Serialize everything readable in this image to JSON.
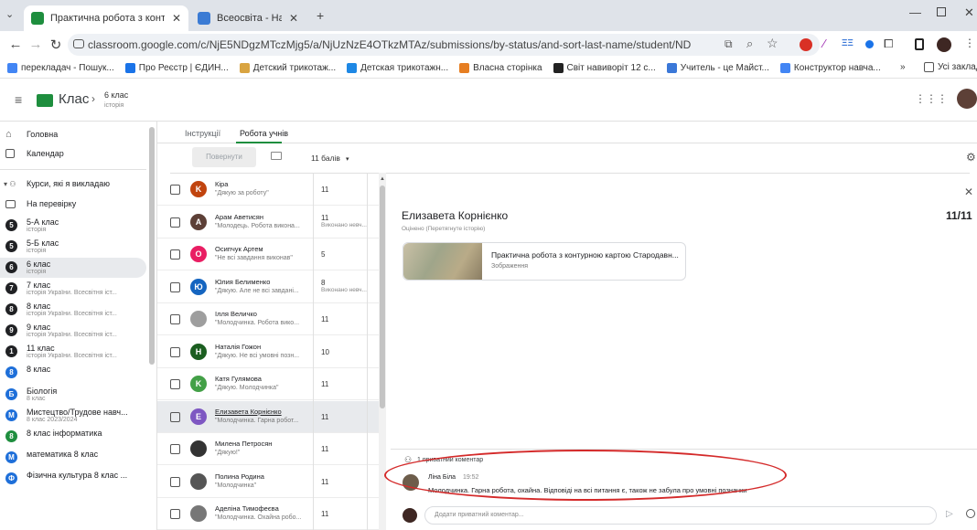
{
  "browser": {
    "tabs": [
      {
        "title": "Практична робота з контурно",
        "close": "✕"
      },
      {
        "title": "Всеосвіта - Національна освіт",
        "close": "✕"
      }
    ],
    "new_tab": "+",
    "url": "classroom.google.com/c/NjE5NDgzMTczMjg5/a/NjUzNzE4OTkzMTAz/submissions/by-status/and-sort-last-name/student/NDIyMDI5MDA0ODMx",
    "bookmarks": [
      {
        "label": "перекладач - Пошук...",
        "color": "#4285f4"
      },
      {
        "label": "Про Реєстр | ЄДИН...",
        "color": "#1a73e8"
      },
      {
        "label": "Детский трикотаж...",
        "color": "#d9a441"
      },
      {
        "label": "Детская трикотажн...",
        "color": "#1e88e5"
      },
      {
        "label": "Власна сторінка",
        "color": "#e67e22"
      },
      {
        "label": "Світ навиворіт 12 с...",
        "color": "#222222"
      },
      {
        "label": "Учитель - це Майст...",
        "color": "#3b78d8"
      },
      {
        "label": "Конструктор навча...",
        "color": "#4285f4"
      }
    ],
    "bookmarks_more": "»",
    "all_bookmarks": "Усі заклад"
  },
  "app": {
    "class_label": "Клас",
    "crumb_title": "6 клас",
    "crumb_sub": "історія"
  },
  "sidebar": {
    "home": "Головна",
    "calendar": "Календар",
    "teaching": "Курси, які я викладаю",
    "review": "На перевірку",
    "classes": [
      {
        "letter": "5",
        "title": "5-А клас",
        "sub": "історія",
        "color": "#202124"
      },
      {
        "letter": "5",
        "title": "5-Б клас",
        "sub": "історія",
        "color": "#202124"
      },
      {
        "letter": "6",
        "title": "6 клас",
        "sub": "історія",
        "color": "#202124"
      },
      {
        "letter": "7",
        "title": "7 клас",
        "sub": "історія України. Всесвітня іст...",
        "color": "#202124"
      },
      {
        "letter": "8",
        "title": "8 клас",
        "sub": "історія України. Всесвітня іст...",
        "color": "#202124"
      },
      {
        "letter": "9",
        "title": "9 клас",
        "sub": "історія України. Всесвітня іст...",
        "color": "#202124"
      },
      {
        "letter": "1",
        "title": "11 клас",
        "sub": "історія України. Всесвітня іст...",
        "color": "#202124"
      },
      {
        "letter": "8",
        "title": "8 клас",
        "sub": "",
        "color": "#1e6fd9"
      },
      {
        "letter": "Б",
        "title": "Біологія",
        "sub": "8 клас",
        "color": "#1e6fd9"
      },
      {
        "letter": "М",
        "title": "Мистецтво/Трудове навч...",
        "sub": "8 клас 2023/2024",
        "color": "#1e6fd9"
      },
      {
        "letter": "8",
        "title": "8 клас інформатика",
        "sub": "",
        "color": "#1e8e3e"
      },
      {
        "letter": "М",
        "title": "математика 8 клас",
        "sub": "",
        "color": "#1e6fd9"
      },
      {
        "letter": "Ф",
        "title": "Фізична культура 8 клас ...",
        "sub": "",
        "color": "#1e6fd9"
      }
    ]
  },
  "main": {
    "tabs": [
      "Інструкції",
      "Робота учнів"
    ],
    "return_button": "Повернути",
    "points_select": "11 балів",
    "students": [
      {
        "initial": "K",
        "color": "#c1440e",
        "name": "Кіра",
        "comment": "\"Дякую за роботу\"",
        "grade": "11",
        "grade_sub": ""
      },
      {
        "initial": "A",
        "color": "#5d4037",
        "name": "Арам Аветисян",
        "comment": "\"Молодець. Робота викона...",
        "grade": "11",
        "grade_sub": "Виконано невч..."
      },
      {
        "initial": "O",
        "color": "#e91e63",
        "name": "Осипчук Артем",
        "comment": "\"Не всі завдання виконав\"",
        "grade": "5",
        "grade_sub": ""
      },
      {
        "initial": "Ю",
        "color": "#1565c0",
        "name": "Юлия Белименко",
        "comment": "\"Дякую. Але не всі завдані...",
        "grade": "8",
        "grade_sub": "Виконано невч..."
      },
      {
        "initial": "",
        "color": "#9e9e9e",
        "name": "Ілля Величко",
        "comment": "\"Молодчинка. Робота вико...",
        "grade": "11",
        "grade_sub": ""
      },
      {
        "initial": "H",
        "color": "#1b5e20",
        "name": "Наталія Гожон",
        "comment": "\"Дякую. Не всі умовні позн...",
        "grade": "10",
        "grade_sub": ""
      },
      {
        "initial": "K",
        "color": "#43a047",
        "name": "Катя Гулямова",
        "comment": "\"Дякую. Молодчинка\"",
        "grade": "11",
        "grade_sub": ""
      },
      {
        "initial": "E",
        "color": "#7e57c2",
        "name": "Елизавета Корнієнко",
        "comment": "\"Молодчинка. Гарна робот...",
        "grade": "11",
        "grade_sub": ""
      },
      {
        "initial": "",
        "color": "#333333",
        "name": "Милена Петросян",
        "comment": "\"Дякую!\"",
        "grade": "11",
        "grade_sub": ""
      },
      {
        "initial": "",
        "color": "#555555",
        "name": "Полина Родина",
        "comment": "\"Молодчинка\"",
        "grade": "11",
        "grade_sub": ""
      },
      {
        "initial": "",
        "color": "#777777",
        "name": "Аделіна Тимофеєва",
        "comment": "\"Молодчинка. Охайна робо...",
        "grade": "11",
        "grade_sub": ""
      }
    ],
    "detail": {
      "name": "Елизавета Корнієнко",
      "status": "Оцінено (Перетягнуте історію)",
      "grade": "11/11",
      "attachment_title": "Практична робота з контурною картою Стародавн...",
      "attachment_type": "Зображення",
      "private_comments_label": "1 приватний коментар",
      "comment_author": "Ліна Біла",
      "comment_time": "19:52",
      "comment_text": "Молодчинка. Гарна робота, охайна. Відповіді на всі питання є, також не забула про умовні позначки",
      "add_comment_placeholder": "Додати приватний коментар..."
    }
  },
  "colors": {
    "annotation": "#d42a2a",
    "accent": "#1a73e8",
    "selected_row": "#e8eaed"
  }
}
